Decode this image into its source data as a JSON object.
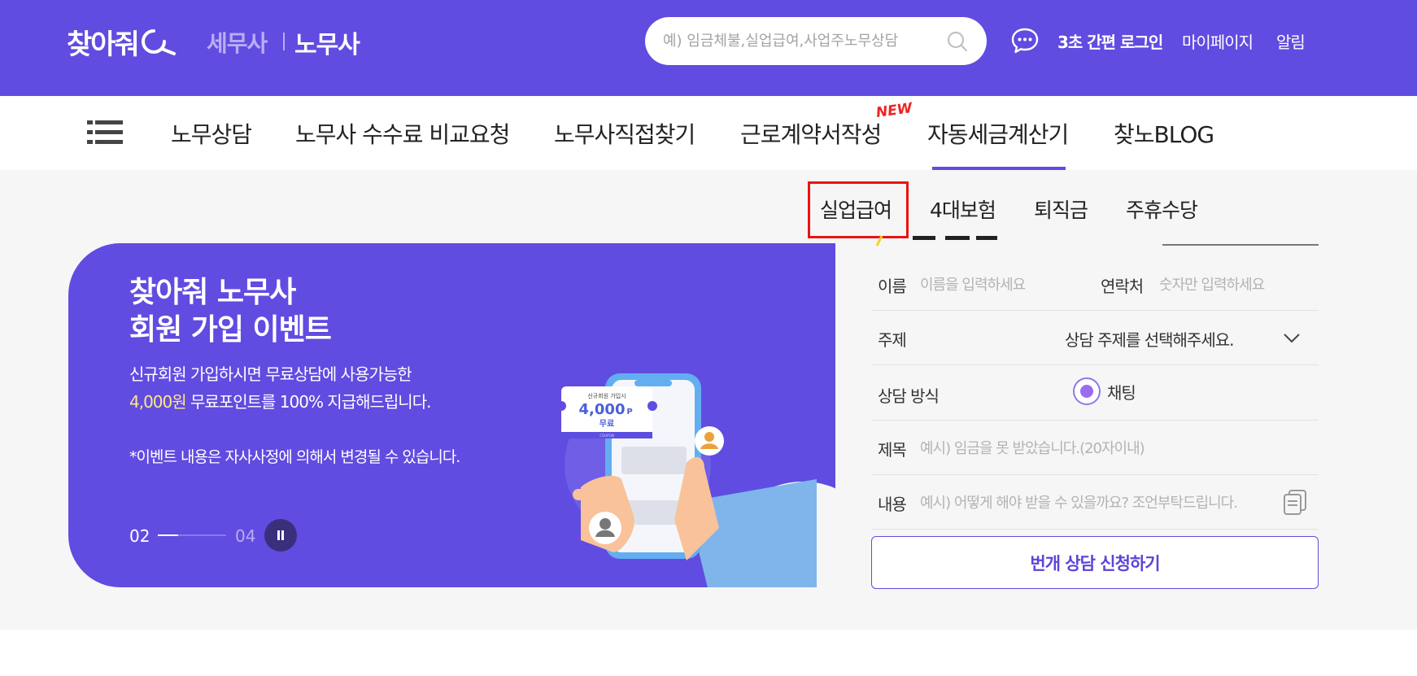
{
  "header": {
    "logo_text": "찾아줘",
    "brand_tax": "세무사",
    "brand_labor": "노무사",
    "search_placeholder": "예) 임금체불,실업급여,사업주노무상담",
    "quick_login": "3초 간편 로그인",
    "mypage": "마이페이지",
    "alarm": "알림",
    "accent_color": "#604ce0"
  },
  "nav": {
    "items": [
      {
        "label": "노무상담"
      },
      {
        "label": "노무사 수수료 비교요청"
      },
      {
        "label": "노무사직접찾기"
      },
      {
        "label": "근로계약서작성"
      },
      {
        "label": "자동세금계산기"
      },
      {
        "label": "찾노BLOG"
      }
    ],
    "new_badge": "NEW",
    "active_index": 4
  },
  "subnav": {
    "items": [
      {
        "label": "실업급여"
      },
      {
        "label": "4대보험"
      },
      {
        "label": "퇴직금"
      },
      {
        "label": "주휴수당"
      }
    ],
    "highlight_index": 0
  },
  "banner": {
    "title_line1": "찾아줘 노무사",
    "title_line2": "회원 가입 이벤트",
    "desc_line1": "신규회원 가입하시면 무료상담에 사용가능한",
    "desc_amount": "4,000원",
    "desc_line2_rest": " 무료포인트를 100% 지급해드립니다.",
    "note": "*이벤트 내용은 자사사정에 의해서 변경될 수 있습니다.",
    "pager_current": "02",
    "pager_total": "04",
    "pager_progress": 0.3,
    "coupon_title": "신규회원 가입시",
    "coupon_amount": "4,000",
    "coupon_unit": "P",
    "coupon_free": "무료",
    "coupon_footer": "COUPON"
  },
  "form": {
    "name_label": "이름",
    "name_placeholder": "이름을 입력하세요",
    "contact_label": "연락처",
    "contact_placeholder": "숫자만 입력하세요",
    "topic_label": "주제",
    "topic_value": "상담 주제를 선택해주세요.",
    "method_label": "상담 방식",
    "method_option": "채팅",
    "subject_label": "제목",
    "subject_placeholder": "예시) 임금을 못 받았습니다.(20자이내)",
    "content_label": "내용",
    "content_placeholder": "예시) 어떻게 해야 받을 수 있을까요? 조언부탁드립니다.",
    "submit_label": "번개 상담 신청하기"
  }
}
